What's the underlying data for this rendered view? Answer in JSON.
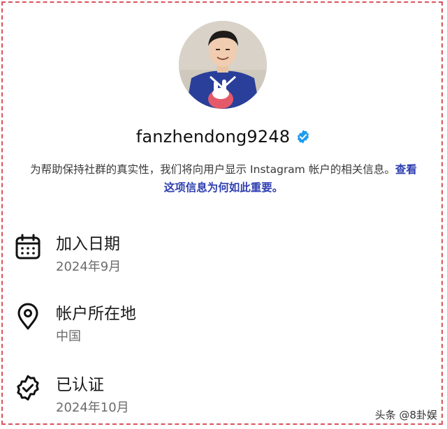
{
  "profile": {
    "username": "fanzhendong9248",
    "description_text": "为帮助保持社群的真实性，我们将向用户显示 Instagram 帐户的相关信息。",
    "description_link": "查看这项信息为何如此重要。"
  },
  "info_rows": [
    {
      "icon": "calendar-icon",
      "title": "加入日期",
      "value": "2024年9月"
    },
    {
      "icon": "location-pin-icon",
      "title": "帐户所在地",
      "value": "中国"
    },
    {
      "icon": "verified-badge-icon",
      "title": "已认证",
      "value": "2024年10月"
    }
  ],
  "watermark": "头条 @8卦娱",
  "colors": {
    "verified_badge": "#1d9bf0",
    "link": "#2f3fb0",
    "frame_border": "#d9535b"
  }
}
